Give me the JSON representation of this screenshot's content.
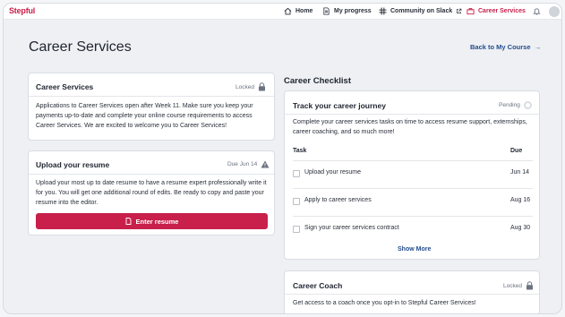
{
  "nav": {
    "logo": "Stepful",
    "items": [
      {
        "label": "Home",
        "icon": "home-icon"
      },
      {
        "label": "My progress",
        "icon": "document-icon"
      },
      {
        "label": "Community on Slack",
        "icon": "slack-icon"
      },
      {
        "label": "Career Services",
        "icon": "briefcase-icon",
        "active": true
      }
    ]
  },
  "page": {
    "title": "Career Services",
    "back_link": "Back to My Course"
  },
  "career_services_card": {
    "title": "Career Services",
    "status": "Locked",
    "body": "Applications to Career Services open after Week 11. Make sure you keep your payments up-to-date and complete your online course requirements to access Career Services. We are excited to welcome you to Career Services!"
  },
  "resume_card": {
    "title": "Upload your resume",
    "status": "Due Jun 14",
    "body": "Upload your most up to date resume to have a resume expert professionally write it for you. You will get one additional round of edits. Be ready to copy and paste your resume into the editor.",
    "button": "Enter resume"
  },
  "checklist": {
    "section_title": "Career Checklist",
    "card_title": "Track your career journey",
    "status": "Pending",
    "body": "Complete your career services tasks on time to access resume support, externships, career coaching, and so much more!",
    "col_task": "Task",
    "col_due": "Due",
    "tasks": [
      {
        "label": "Upload your resume",
        "due": "Jun 14"
      },
      {
        "label": "Apply to career services",
        "due": "Aug 16"
      },
      {
        "label": "Sign your career services contract",
        "due": "Aug 30"
      }
    ],
    "show_more": "Show More"
  },
  "coach_card": {
    "title": "Career Coach",
    "status": "Locked",
    "body": "Get access to a coach once you opt-in to Stepful Career Services!"
  },
  "colors": {
    "brand": "#c8204b",
    "link": "#234c8e",
    "background": "#eef0f3"
  }
}
